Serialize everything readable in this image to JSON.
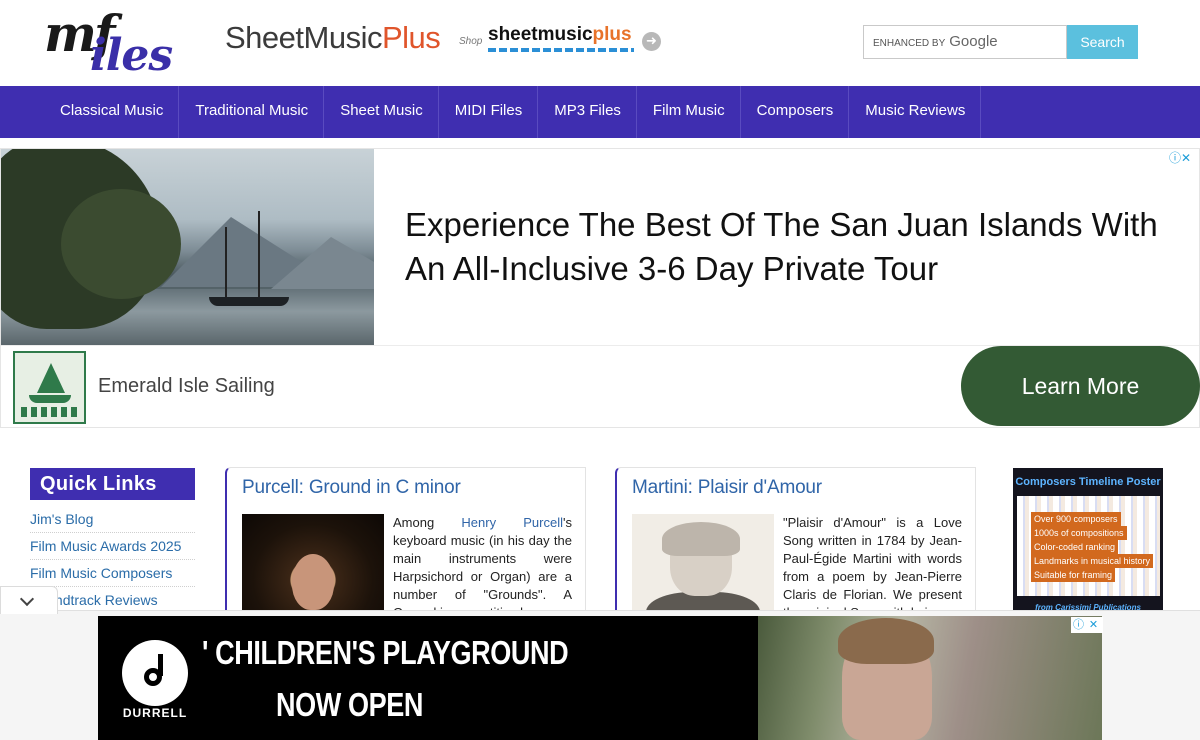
{
  "header": {
    "logo": {
      "part1": "mf",
      "part2": "iles"
    },
    "partner_logo": {
      "name": "SheetMusic",
      "plus": "Plus"
    },
    "shop_banner": {
      "shop": "Shop",
      "brand": "sheetmusic",
      "brand_plus": "plus"
    },
    "search": {
      "enhanced_by": "ENHANCED BY",
      "provider": "Google",
      "button_label": "Search"
    }
  },
  "nav": {
    "items": [
      {
        "label": "Classical Music"
      },
      {
        "label": "Traditional Music"
      },
      {
        "label": "Sheet Music"
      },
      {
        "label": "MIDI Files"
      },
      {
        "label": "MP3 Files"
      },
      {
        "label": "Film Music"
      },
      {
        "label": "Composers"
      },
      {
        "label": "Music Reviews"
      }
    ]
  },
  "ad_top": {
    "headline": "Experience The Best Of The San Juan Islands With An All-Inclusive 3-6 Day Private Tour",
    "advertiser": "Emerald Isle Sailing",
    "cta": "Learn More",
    "info_icons": "ⓘ✕"
  },
  "sidebar": {
    "title": "Quick Links",
    "links": [
      {
        "label": "Jim's Blog"
      },
      {
        "label": "Film Music Awards 2025"
      },
      {
        "label": "Film Music Composers"
      },
      {
        "label": "Soundtrack Reviews"
      }
    ]
  },
  "cards": {
    "purcell": {
      "title": "Purcell: Ground in C minor",
      "text_before_link": "Among ",
      "link": "Henry Purcell",
      "text_after_link": "'s keyboard music (in his day the main instruments were Harpsichord or Organ) are a number of \"Grounds\". A Ground is a repetitive bass"
    },
    "martini": {
      "title": "Martini: Plaisir d'Amour",
      "text": "\"Plaisir d'Amour\" is a Love Song written in 1784 by Jean-Paul-Égide Martini with words from a poem by Jean-Pierre Claris de Florian. We present the original Song with lyrics"
    }
  },
  "poster": {
    "title": "Composers Timeline Poster",
    "bullets": [
      "Over 900 composers",
      "1000s of compositions",
      "Color-coded ranking",
      "Landmarks in musical history",
      "Suitable for framing"
    ],
    "publisher": "from Carissimi Publications"
  },
  "bottom_ad": {
    "brand": "DURRELL",
    "line1": "' CHILDREN'S PLAYGROUND",
    "line2": "NOW OPEN",
    "controls": [
      "ⓘ",
      "✕"
    ]
  }
}
